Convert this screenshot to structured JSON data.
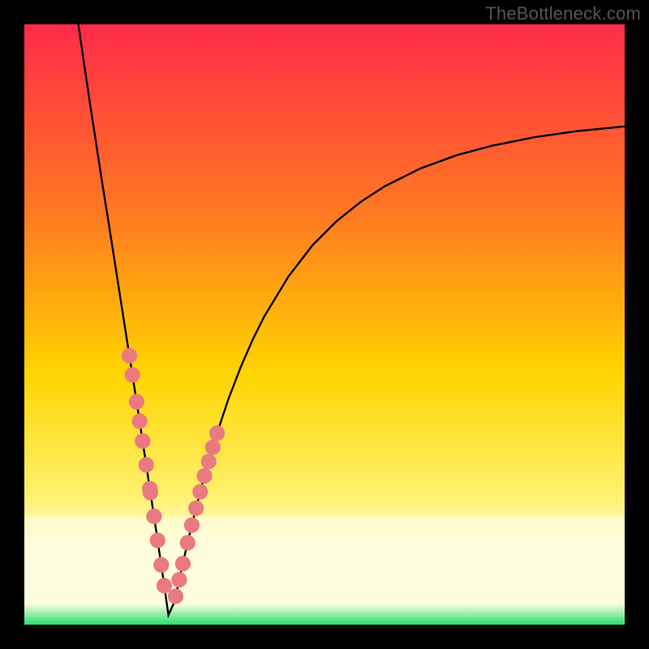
{
  "watermark": "TheBottleneck.com",
  "colors": {
    "frame": "#000000",
    "grad_top": "#ff2b4a",
    "grad_mid1": "#ff7a20",
    "grad_mid2": "#ffd400",
    "grad_mid3": "#fff06a",
    "grad_band": "#fffde0",
    "grad_green": "#25e06d",
    "curve": "#000000",
    "marker": "#ea7a80"
  },
  "chart_data": {
    "type": "line",
    "title": "",
    "xlabel": "",
    "ylabel": "",
    "xlim": [
      0,
      100
    ],
    "ylim": [
      0,
      100
    ],
    "notch_x": 24,
    "left_top_x": 9,
    "right_y_at_100": 83,
    "series": [
      {
        "name": "bottleneck-curve",
        "x": [
          9,
          10,
          11,
          12,
          13,
          14,
          15,
          16,
          17,
          18,
          19,
          20,
          21,
          22,
          23,
          24,
          25,
          26,
          27,
          28,
          29,
          30,
          32,
          34,
          36,
          38,
          40,
          44,
          48,
          52,
          56,
          60,
          66,
          72,
          78,
          85,
          92,
          100
        ],
        "y": [
          100,
          93.1,
          86.4,
          79.9,
          73.4,
          67.2,
          60.8,
          54.4,
          48.0,
          41.6,
          35.2,
          28.6,
          22.0,
          15.4,
          8.6,
          1.6,
          3.8,
          8.4,
          12.8,
          17.0,
          21.0,
          24.8,
          31.6,
          37.6,
          42.8,
          47.4,
          51.4,
          58.0,
          63.2,
          67.2,
          70.4,
          73.0,
          76.0,
          78.2,
          79.8,
          81.2,
          82.2,
          83.0
        ]
      }
    ],
    "markers": {
      "left_cluster_x": [
        17.5,
        18.0,
        18.7,
        19.2,
        19.7,
        20.3,
        20.9,
        21.0,
        21.6,
        22.2,
        22.8,
        23.3
      ],
      "right_cluster_x": [
        25.2,
        25.8,
        26.4,
        27.2,
        27.9,
        28.6,
        29.3,
        30.0,
        30.7,
        31.4,
        32.1
      ],
      "radius": 1.3
    },
    "green_band_y": [
      2.0,
      2.5
    ]
  }
}
